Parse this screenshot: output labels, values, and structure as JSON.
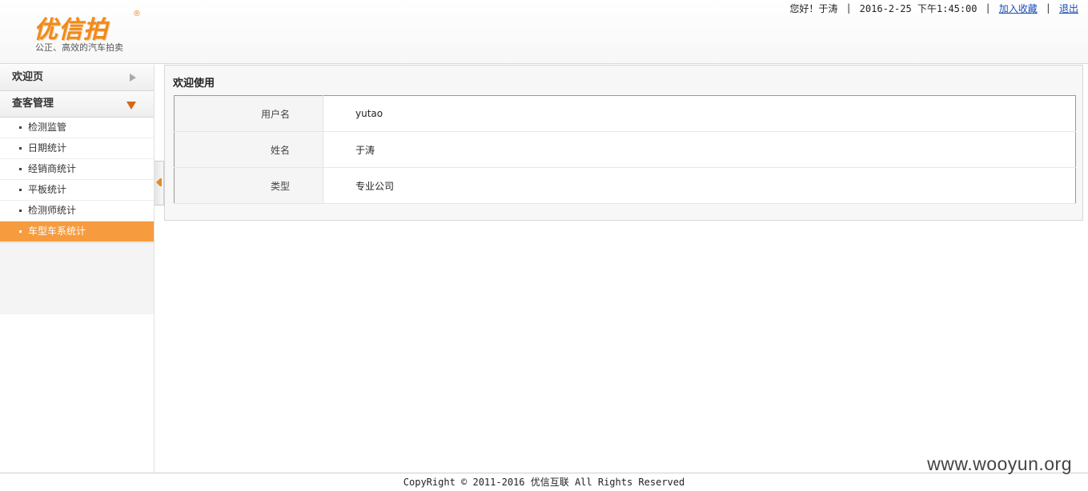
{
  "header": {
    "logo_text": "优信拍",
    "logo_reg": "®",
    "logo_slogan": "公正、高效的汽车拍卖",
    "greeting": "您好！于涛",
    "datetime": "2016-2-25 下午1:45:00",
    "favorite_link": "加入收藏",
    "logout_link": "退出",
    "separator": "|"
  },
  "sidebar": {
    "groups": [
      {
        "label": "欢迎页"
      },
      {
        "label": "查客管理"
      }
    ],
    "items": [
      {
        "label": "检测监管"
      },
      {
        "label": "日期统计"
      },
      {
        "label": "经销商统计"
      },
      {
        "label": "平板统计"
      },
      {
        "label": "检测师统计"
      },
      {
        "label": "车型车系统计"
      }
    ],
    "active_item": "车型车系统计"
  },
  "main": {
    "title": "欢迎使用",
    "rows": [
      {
        "label": "用户名",
        "value": "yutao"
      },
      {
        "label": "姓名",
        "value": "于涛"
      },
      {
        "label": "类型",
        "value": "专业公司"
      }
    ]
  },
  "footer": {
    "copyright": "CopyRight © 2011-2016 优信互联 All Rights Reserved"
  },
  "watermark": "www.wooyun.org",
  "colors": {
    "accent": "#f79b3f",
    "logo": "#f08a1c",
    "link": "#1a4fb5",
    "arrow": "#d5651a"
  }
}
